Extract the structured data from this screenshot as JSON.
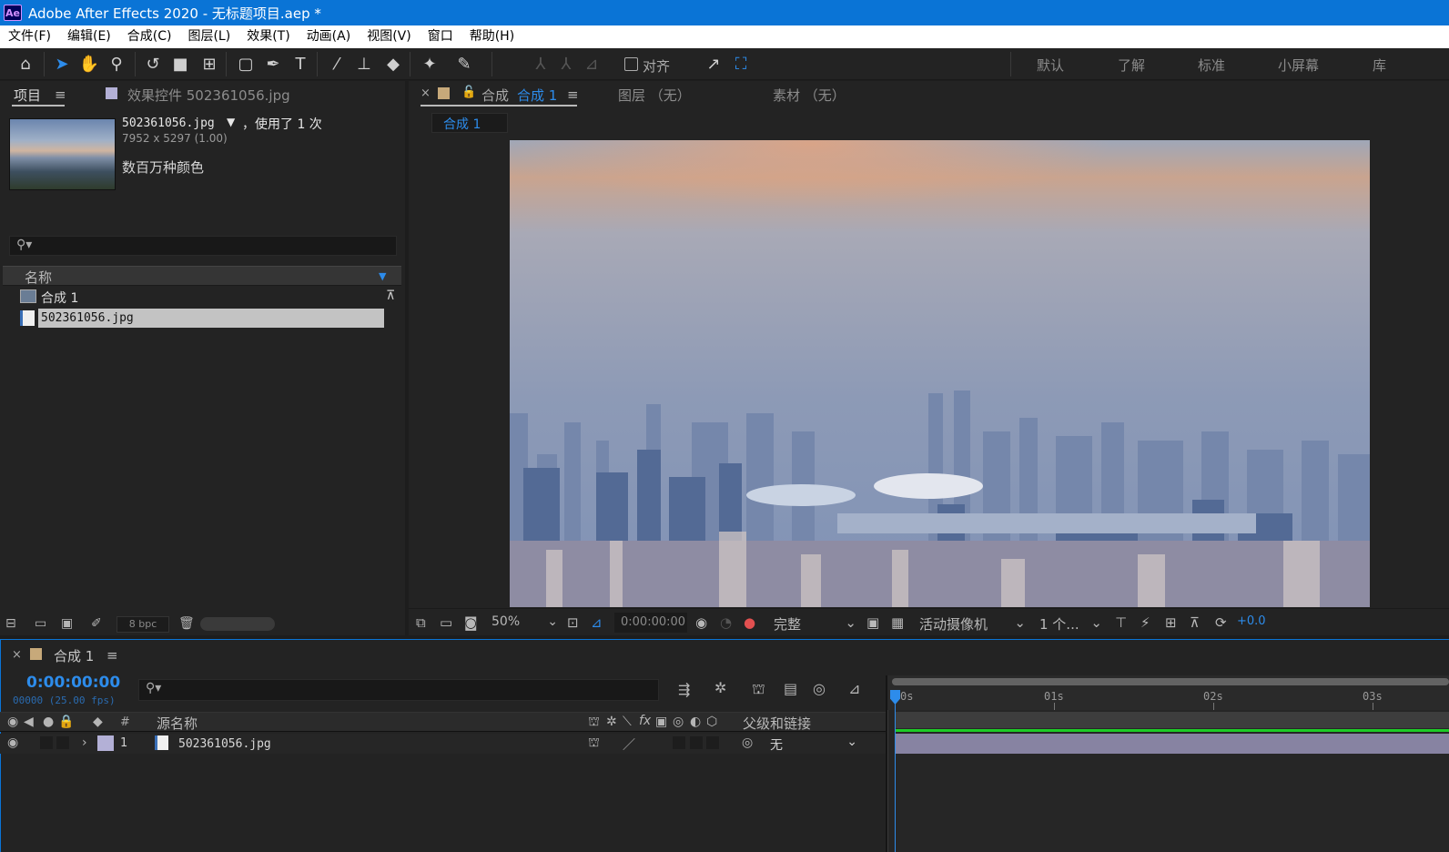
{
  "app": {
    "logo": "Ae",
    "title": "Adobe After Effects 2020 - 无标题项目.aep *"
  },
  "menu": [
    "文件(F)",
    "编辑(E)",
    "合成(C)",
    "图层(L)",
    "效果(T)",
    "动画(A)",
    "视图(V)",
    "窗口",
    "帮助(H)"
  ],
  "toolbar": {
    "snap_label": "对齐",
    "workspaces": [
      "默认",
      "了解",
      "标准",
      "小屏幕",
      "库"
    ]
  },
  "project": {
    "tab_project": "项目",
    "tab_effects": "效果控件 502361056.jpg",
    "selected_name": "502361056.jpg",
    "usage": "，使用了 1 次",
    "dimensions": "7952 x 5297 (1.00)",
    "colors": "数百万种颜色",
    "column_name": "名称",
    "items": [
      {
        "name": "合成 1",
        "type": "composition"
      },
      {
        "name": "502361056.jpg",
        "type": "footage"
      }
    ],
    "bpc": "8 bpc"
  },
  "viewer": {
    "tab_comp_prefix": "合成",
    "tab_comp_name": "合成 1",
    "tab_layer": "图层 （无）",
    "tab_footage": "素材 （无）",
    "breadcrumb": "合成 1",
    "zoom": "50%",
    "timecode": "0:00:00:00",
    "resolution": "完整",
    "camera": "活动摄像机",
    "views": "1 个...",
    "exposure": "+0.0"
  },
  "timeline": {
    "tab": "合成 1",
    "timecode": "0:00:00:00",
    "frame_info": "00000 (25.00 fps)",
    "col_number": "#",
    "col_source": "源名称",
    "col_parent": "父级和链接",
    "layers": [
      {
        "number": "1",
        "name": "502361056.jpg",
        "parent": "无",
        "label_color": "#b3b0d6"
      }
    ],
    "ruler": [
      "0s",
      "01s",
      "02s",
      "03s"
    ]
  },
  "colors": {
    "accent": "#2d8ceb",
    "titlebar": "#0a74d6",
    "layer_bar": "#8783a2",
    "green": "#1ecc27"
  }
}
